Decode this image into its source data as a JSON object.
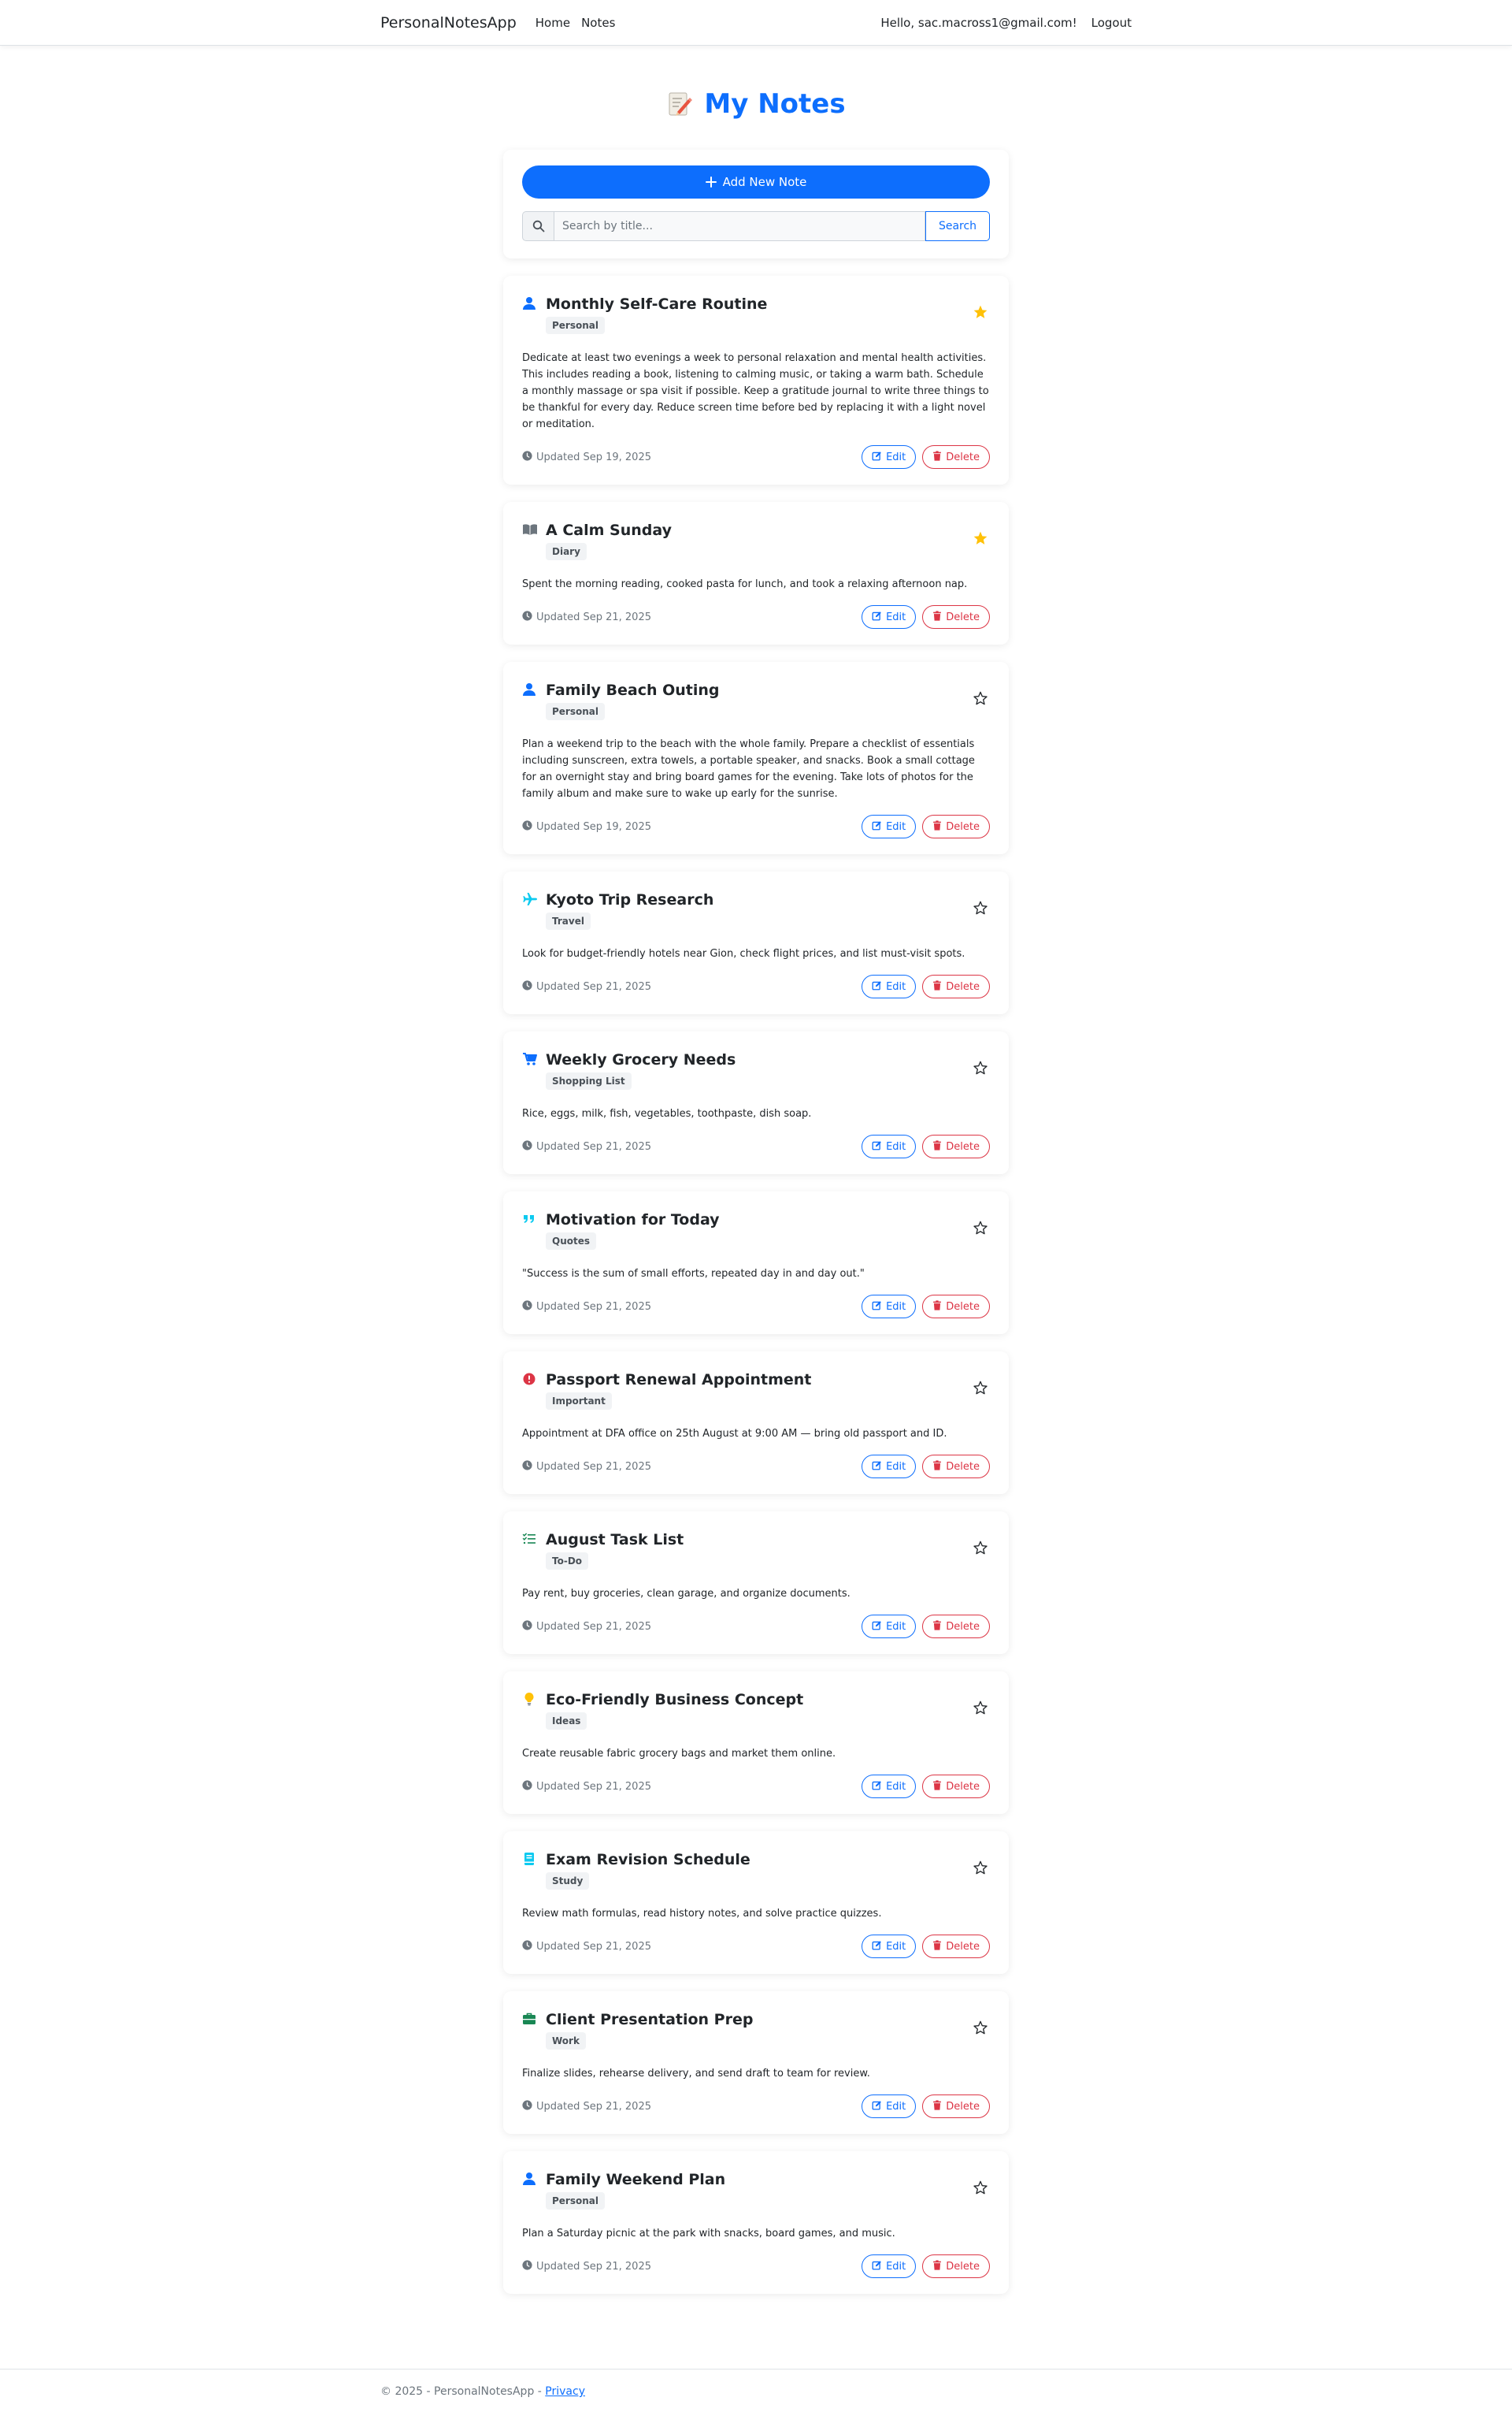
{
  "navbar": {
    "brand": "PersonalNotesApp",
    "links": [
      "Home",
      "Notes"
    ],
    "greeting": "Hello, sac.macross1@gmail.com!",
    "logout": "Logout"
  },
  "page": {
    "title": "My Notes"
  },
  "controls": {
    "add_label": "Add New Note",
    "search_placeholder": "Search by title...",
    "search_button": "Search"
  },
  "notes": [
    {
      "title": "Monthly Self-Care Routine",
      "category": "Personal",
      "icon": "person-icon",
      "starred": true,
      "body": "Dedicate at least two evenings a week to personal relaxation and mental health activities. This includes reading a book, listening to calming music, or taking a warm bath. Schedule a monthly massage or spa visit if possible. Keep a gratitude journal to write three things to be thankful for every day. Reduce screen time before bed by replacing it with a light novel or meditation.",
      "updated": "Updated Sep 19, 2025"
    },
    {
      "title": "A Calm Sunday",
      "category": "Diary",
      "icon": "book-icon",
      "starred": true,
      "body": "Spent the morning reading, cooked pasta for lunch, and took a relaxing afternoon nap.",
      "updated": "Updated Sep 21, 2025"
    },
    {
      "title": "Family Beach Outing",
      "category": "Personal",
      "icon": "person-icon",
      "starred": false,
      "body": "Plan a weekend trip to the beach with the whole family. Prepare a checklist of essentials including sunscreen, extra towels, a portable speaker, and snacks. Book a small cottage for an overnight stay and bring board games for the evening. Take lots of photos for the family album and make sure to wake up early for the sunrise.",
      "updated": "Updated Sep 19, 2025"
    },
    {
      "title": "Kyoto Trip Research",
      "category": "Travel",
      "icon": "airplane-icon",
      "starred": false,
      "body": "Look for budget-friendly hotels near Gion, check flight prices, and list must-visit spots.",
      "updated": "Updated Sep 21, 2025"
    },
    {
      "title": "Weekly Grocery Needs",
      "category": "Shopping List",
      "icon": "cart-icon",
      "starred": false,
      "body": "Rice, eggs, milk, fish, vegetables, toothpaste, dish soap.",
      "updated": "Updated Sep 21, 2025"
    },
    {
      "title": "Motivation for Today",
      "category": "Quotes",
      "icon": "quote-icon",
      "starred": false,
      "body": "\"Success is the sum of small efforts, repeated day in and day out.\"",
      "updated": "Updated Sep 21, 2025"
    },
    {
      "title": "Passport Renewal Appointment",
      "category": "Important",
      "icon": "alert-icon",
      "starred": false,
      "body": "Appointment at DFA office on 25th August at 9:00 AM — bring old passport and ID.",
      "updated": "Updated Sep 21, 2025"
    },
    {
      "title": "August Task List",
      "category": "To-Do",
      "icon": "checklist-icon",
      "starred": false,
      "body": "Pay rent, buy groceries, clean garage, and organize documents.",
      "updated": "Updated Sep 21, 2025"
    },
    {
      "title": "Eco-Friendly Business Concept",
      "category": "Ideas",
      "icon": "lightbulb-icon",
      "starred": false,
      "body": "Create reusable fabric grocery bags and market them online.",
      "updated": "Updated Sep 21, 2025"
    },
    {
      "title": "Exam Revision Schedule",
      "category": "Study",
      "icon": "notebook-icon",
      "starred": false,
      "body": "Review math formulas, read history notes, and solve practice quizzes.",
      "updated": "Updated Sep 21, 2025"
    },
    {
      "title": "Client Presentation Prep",
      "category": "Work",
      "icon": "briefcase-icon",
      "starred": false,
      "body": "Finalize slides, rehearse delivery, and send draft to team for review.",
      "updated": "Updated Sep 21, 2025"
    },
    {
      "title": "Family Weekend Plan",
      "category": "Personal",
      "icon": "person-icon",
      "starred": false,
      "body": "Plan a Saturday picnic at the park with snacks, board games, and music.",
      "updated": "Updated Sep 21, 2025"
    }
  ],
  "buttons": {
    "edit": "Edit",
    "delete": "Delete"
  },
  "footer": {
    "text": "© 2025 - PersonalNotesApp - ",
    "privacy": "Privacy"
  },
  "colors": {
    "primary": "#0d6efd",
    "danger": "#dc3545",
    "star": "#ffc107",
    "person": "#0d6efd",
    "book": "#6c757d",
    "airplane": "#0dcaf0",
    "cart": "#0d6efd",
    "quote": "#0dcaf0",
    "alert": "#dc3545",
    "checklist": "#198754",
    "lightbulb": "#ffc107",
    "notebook": "#0dcaf0",
    "briefcase": "#198754"
  }
}
